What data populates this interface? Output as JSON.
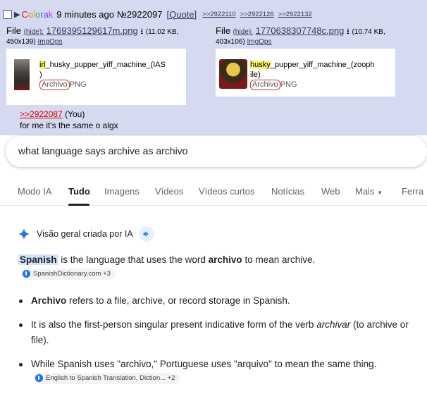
{
  "post": {
    "name_letters": [
      "C",
      "o",
      "l",
      "o",
      "r",
      "a",
      "k",
      ""
    ],
    "time": "9 minutes ago",
    "number": "№2922097",
    "quote_label": "[Quote]",
    "backlinks": [
      ">>2922110",
      ">>2922126",
      ">>2922132"
    ],
    "files": [
      {
        "prefix": "File",
        "hide": "(hide):",
        "filename": "1769395129617m.png",
        "size": "(11.02 KB,",
        "dims": "450x139)",
        "imgops": "ImgOps",
        "label_hl": "irl",
        "label_rest": "_husky_pupper_yiff_machine_(IAS",
        "label_line2": ")",
        "archivo": "Archivo",
        "png": "PNG"
      },
      {
        "prefix": "File",
        "hide": "(hide):",
        "filename": "1770638307748c.png",
        "size": "(10.74 KB,",
        "dims": "403x106)",
        "imgops": "ImgOps",
        "label_hl": "husky",
        "label_rest": "_pupper_yiff_machine_(zooph",
        "label_line2": "ile)",
        "archivo": "Archivo",
        "png": "PNG"
      }
    ],
    "quote_ref": ">>2922087",
    "you": "(You)",
    "text": "for me it's the same o algx"
  },
  "search": {
    "query": "what language says archive as archivo"
  },
  "tabs": [
    {
      "label": "Modo IA"
    },
    {
      "label": "Tudo"
    },
    {
      "label": "Imagens"
    },
    {
      "label": "Vídeos"
    },
    {
      "label": "Vídeos curtos"
    },
    {
      "label": "Notícias"
    },
    {
      "label": "Web"
    },
    {
      "label": "Mais"
    },
    {
      "label": "Ferra"
    }
  ],
  "ai": {
    "title": "Visão geral criada por IA",
    "intro_hl": "Spanish",
    "intro_1": " is the language that uses the word ",
    "intro_bold": "archivo",
    "intro_2": " to mean archive.",
    "intro_chip": "SpanishDictionary.com +3",
    "bullets": [
      {
        "bold": "Archivo",
        "text": " refers to a file, archive, or record storage in Spanish."
      },
      {
        "text": "It is also the first-person singular present indicative form of the verb ",
        "italic": "archivar",
        "text2": " (to archive or file)."
      },
      {
        "text": "While Spanish uses \"archivo,\" Portuguese uses \"arquivo\" to mean the same thing.",
        "chip": "English to Spanish Translation, Diction...  +2"
      }
    ]
  },
  "colors": {
    "post_bg": "#d6daf0",
    "link": "#34345c",
    "quote_red": "#dd0000",
    "ai_highlight": "#d3e3fd",
    "text": "#202124"
  }
}
